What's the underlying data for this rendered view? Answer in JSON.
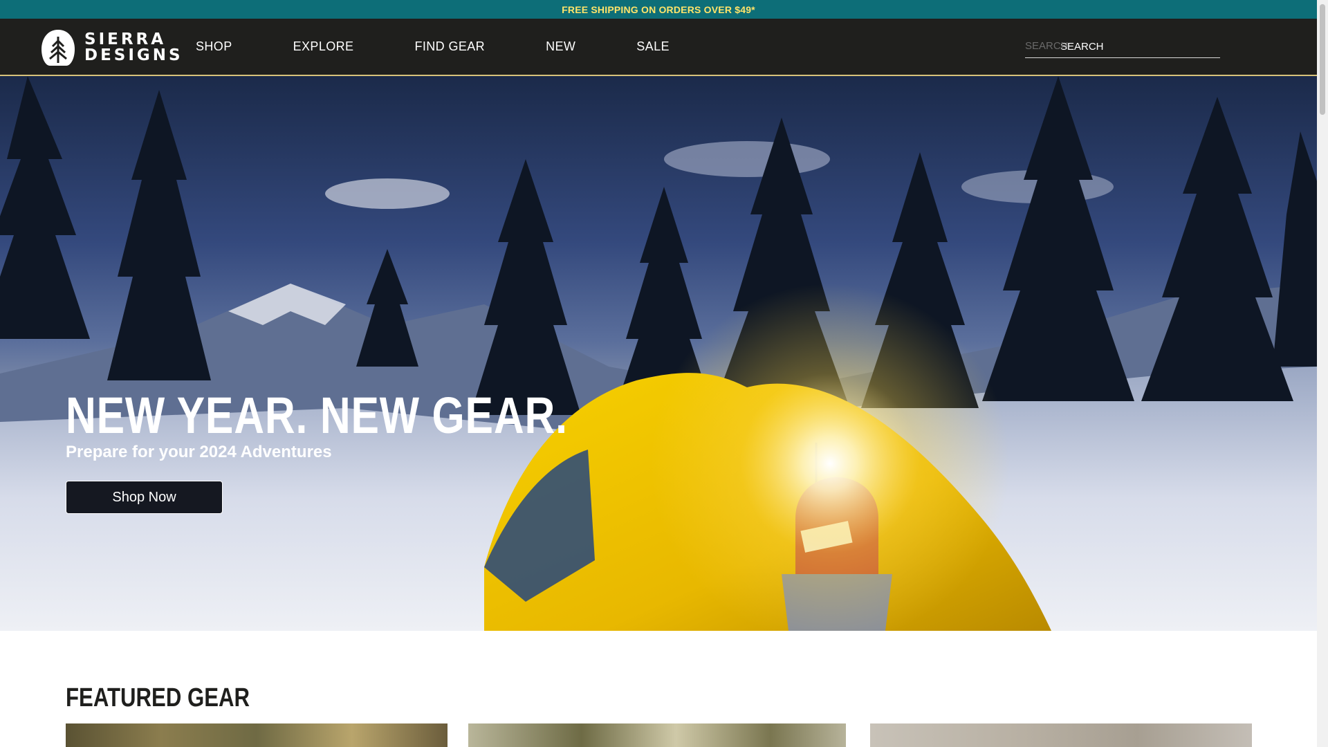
{
  "promo": {
    "text": "FREE SHIPPING ON ORDERS OVER $49*"
  },
  "header": {
    "logo": {
      "line1": "SIERRA",
      "line2": "DESIGNS"
    },
    "nav": [
      {
        "label": "SHOP"
      },
      {
        "label": "EXPLORE"
      },
      {
        "label": "FIND GEAR"
      },
      {
        "label": "NEW"
      },
      {
        "label": "SALE"
      }
    ],
    "search": {
      "ghost": "SEARCH",
      "placeholder": "SEARCH",
      "value": ""
    }
  },
  "hero": {
    "title": "NEW YEAR. NEW GEAR.",
    "subtitle": "Prepare for your 2024 Adventures",
    "button_label": "Shop Now"
  },
  "featured": {
    "title": "FEATURED GEAR"
  },
  "colors": {
    "promo_bg": "#0d6e78",
    "promo_text": "#ffe46a",
    "header_bg": "#1f1f1d",
    "tent_yellow": "#f2c500"
  },
  "icons": {
    "logo": "sierra-designs-tree-logo-icon"
  }
}
